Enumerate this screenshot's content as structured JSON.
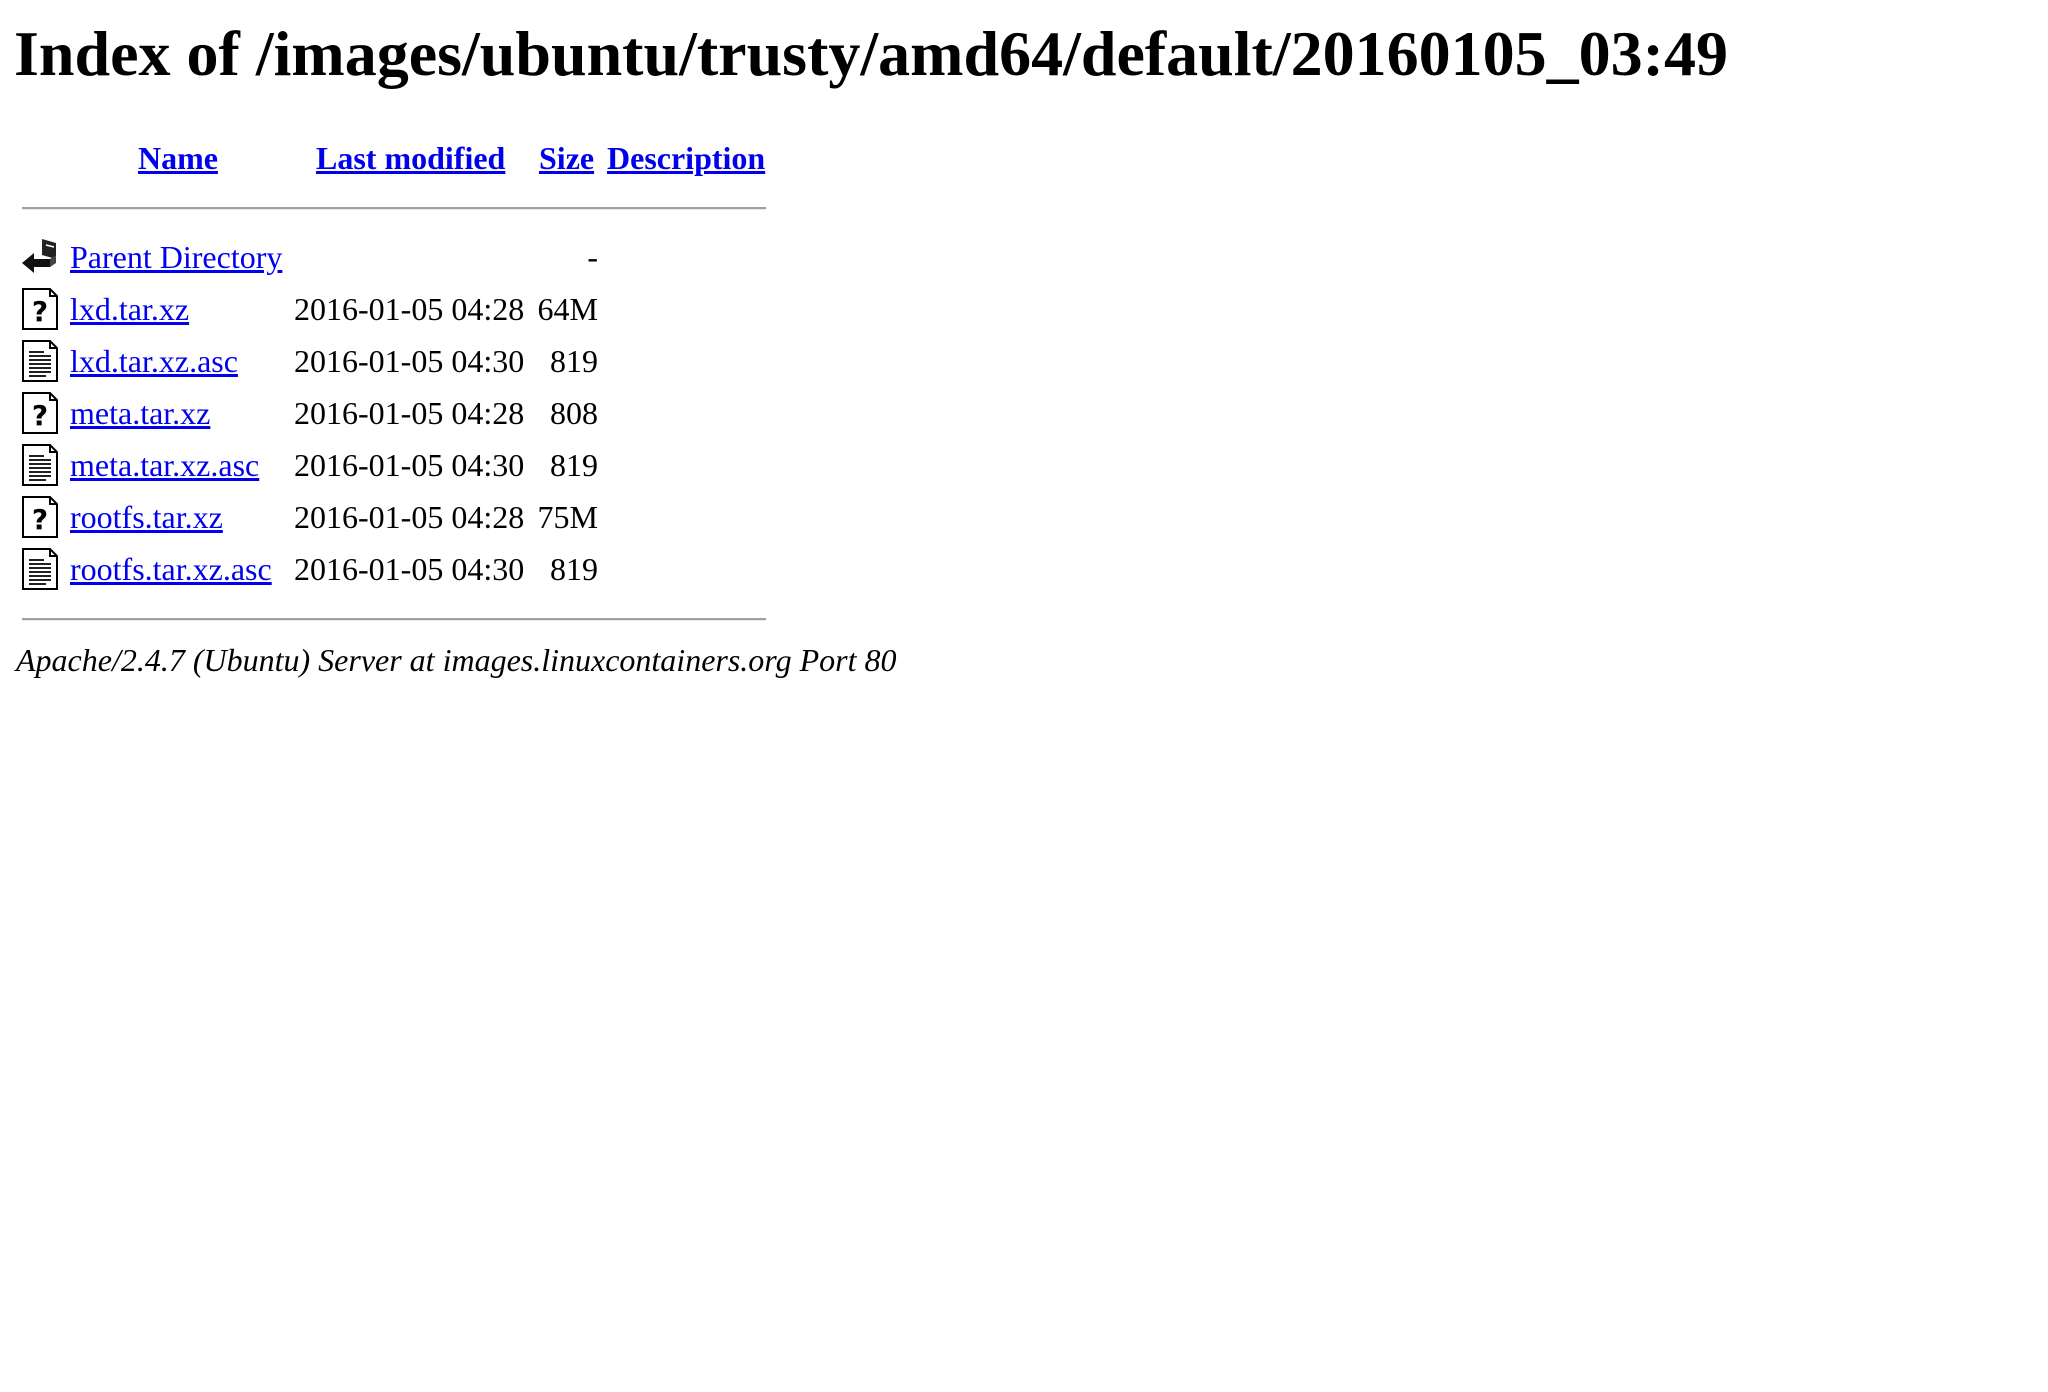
{
  "title": "Index of /images/ubuntu/trusty/amd64/default/20160105_03:49",
  "columns": {
    "name": "Name",
    "last_modified": "Last modified",
    "size": "Size",
    "description": "Description"
  },
  "entries": [
    {
      "icon": "back-arrow-icon",
      "name": "Parent Directory",
      "modified": "",
      "size": "-"
    },
    {
      "icon": "unknown-file-icon",
      "name": "lxd.tar.xz",
      "modified": "2016-01-05 04:28",
      "size": "64M"
    },
    {
      "icon": "text-file-icon",
      "name": "lxd.tar.xz.asc",
      "modified": "2016-01-05 04:30",
      "size": "819"
    },
    {
      "icon": "unknown-file-icon",
      "name": "meta.tar.xz",
      "modified": "2016-01-05 04:28",
      "size": "808"
    },
    {
      "icon": "text-file-icon",
      "name": "meta.tar.xz.asc",
      "modified": "2016-01-05 04:30",
      "size": "819"
    },
    {
      "icon": "unknown-file-icon",
      "name": "rootfs.tar.xz",
      "modified": "2016-01-05 04:28",
      "size": "75M"
    },
    {
      "icon": "text-file-icon",
      "name": "rootfs.tar.xz.asc",
      "modified": "2016-01-05 04:30",
      "size": "819"
    }
  ],
  "footer": "Apache/2.4.7 (Ubuntu) Server at images.linuxcontainers.org Port 80",
  "colors": {
    "link": "#0000ee",
    "rule": "#a0a0a0"
  }
}
